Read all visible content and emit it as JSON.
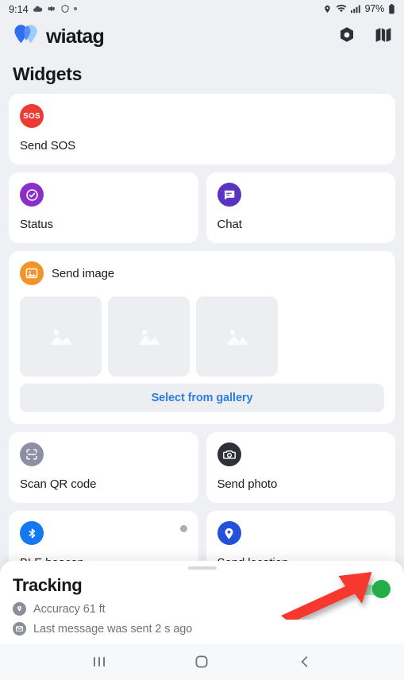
{
  "status_bar": {
    "time": "9:14",
    "battery_percent": "97%",
    "left_icons": [
      "cloud-icon",
      "gear-icon",
      "shield-icon",
      "dot-icon"
    ],
    "right_icons": [
      "location-pin-icon",
      "wifi-icon",
      "signal-bars-icon",
      "battery-icon"
    ]
  },
  "app_bar": {
    "brand_name": "wiatag",
    "logo_icon": "wiatag-logo-icon",
    "actions": [
      {
        "name": "settings-nut-icon",
        "label": "Settings"
      },
      {
        "name": "map-icon",
        "label": "Map"
      }
    ]
  },
  "page": {
    "title": "Widgets"
  },
  "widgets": {
    "sos": {
      "label": "Send SOS",
      "badge_text": "SOS",
      "icon": "sos-icon",
      "color": "#ec3b33"
    },
    "status": {
      "label": "Status",
      "icon": "check-circle-icon",
      "color": "#8b2fc9"
    },
    "chat": {
      "label": "Chat",
      "icon": "chat-bubble-icon",
      "color": "#5b33c4"
    },
    "send_image": {
      "label": "Send image",
      "icon": "image-icon",
      "color": "#f2942a",
      "thumbnails": [
        "image-placeholder-icon",
        "image-placeholder-icon",
        "image-placeholder-icon"
      ],
      "gallery_button": "Select from gallery",
      "gallery_button_color": "#2b7de0"
    },
    "scan_qr": {
      "label": "Scan QR code",
      "icon": "qr-scan-icon",
      "color": "#8f8fa3"
    },
    "send_photo": {
      "label": "Send photo",
      "icon": "camera-icon",
      "color": "#2e3238"
    },
    "ble_beacon": {
      "label": "BLE beacon",
      "icon": "bluetooth-icon",
      "color": "#1479f0",
      "status_dot": "inactive-dot-icon"
    },
    "send_location": {
      "label": "Send location",
      "icon": "location-pin-icon",
      "color": "#2352d8"
    }
  },
  "tracking_sheet": {
    "title": "Tracking",
    "accuracy_text": "Accuracy 61 ft",
    "accuracy_icon": "location-pin-icon",
    "last_message_text": "Last message was sent 2 s ago",
    "last_message_icon": "envelope-icon",
    "toggle": {
      "name": "tracking-toggle",
      "state": "on",
      "color": "#23ad4b"
    },
    "annotation_arrow": {
      "name": "annotation-arrow",
      "color": "#f7392f"
    }
  },
  "nav_bar": {
    "recents": "recents-icon",
    "home": "home-icon",
    "back": "back-icon"
  }
}
